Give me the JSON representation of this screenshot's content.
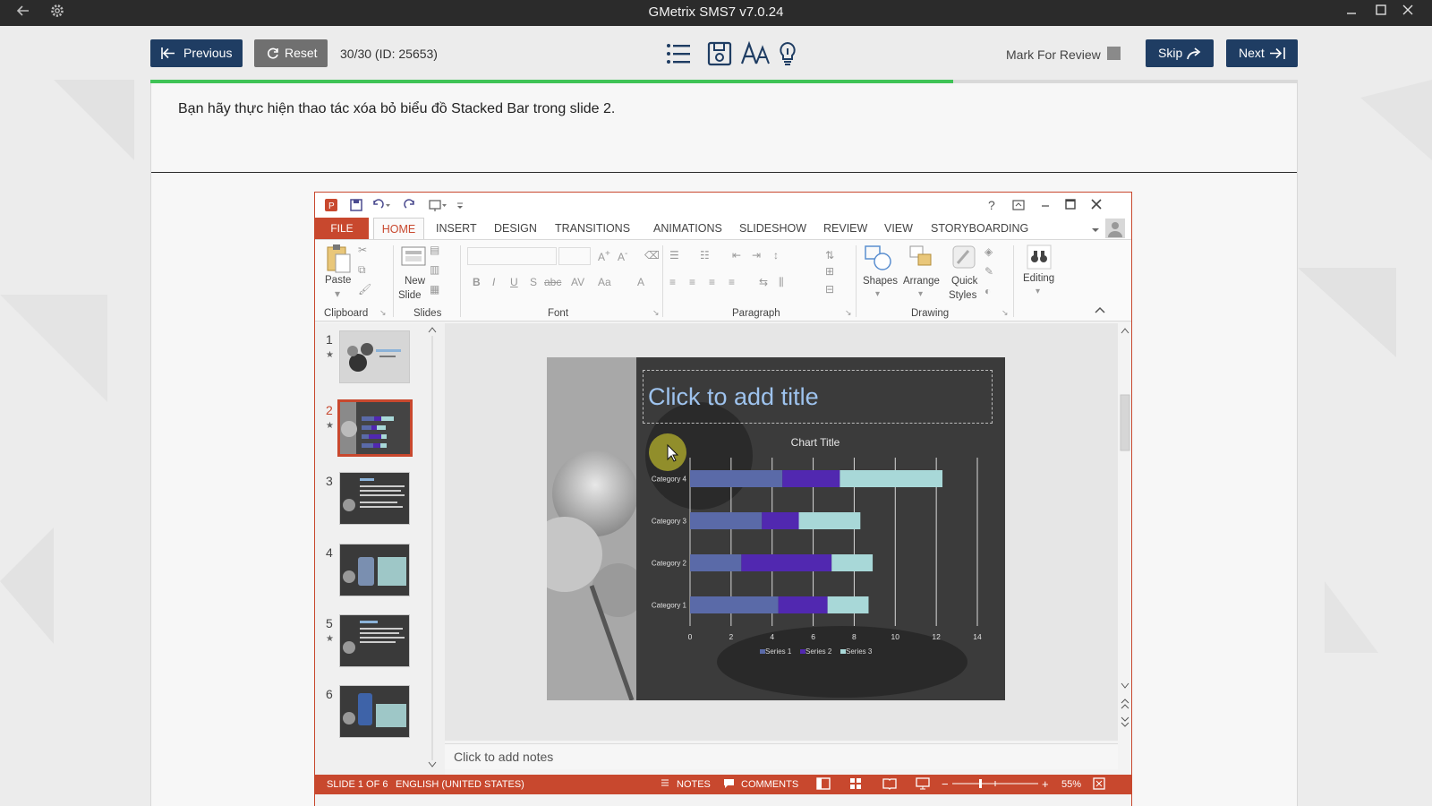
{
  "app": {
    "title": "GMetrix SMS7 v7.0.24"
  },
  "toolbar": {
    "previous_label": "Previous",
    "reset_label": "Reset",
    "question_counter": "30/30 (ID: 25653)",
    "mark_for_review_label": "Mark For Review",
    "mark_for_review_checked": false,
    "skip_label": "Skip",
    "next_label": "Next",
    "tool_icons": [
      "list-icon",
      "save-icon",
      "font-size-icon",
      "hint-icon"
    ],
    "accent_color": "#1f3d63"
  },
  "progress": {
    "fraction": 0.7,
    "color": "#3fc356"
  },
  "question": {
    "text": "Bạn hãy thực hiện thao tác xóa bỏ biểu đồ Stacked Bar trong slide 2."
  },
  "ppt": {
    "accent_color": "#c8482e",
    "qat_icons": [
      "powerpoint-icon",
      "save-icon",
      "undo-icon",
      "redo-icon",
      "touch-mode-icon",
      "customize-icon"
    ],
    "window_controls": [
      "?",
      "restore-ribbon",
      "minimize",
      "maximize",
      "close"
    ],
    "tabs": {
      "file": "FILE",
      "home": "HOME",
      "insert": "INSERT",
      "design": "DESIGN",
      "transitions": "TRANSITIONS",
      "animations": "ANIMATIONS",
      "slideshow": "SLIDESHOW",
      "review": "REVIEW",
      "view": "VIEW",
      "storyboarding": "STORYBOARDING"
    },
    "ribbon": {
      "paste": "Paste",
      "new": "New",
      "slide": "Slide",
      "shapes": "Shapes",
      "arrange": "Arrange",
      "quick": "Quick",
      "styles": "Styles",
      "editing": "Editing",
      "groups": {
        "clipboard": "Clipboard",
        "slides": "Slides",
        "font": "Font",
        "paragraph": "Paragraph",
        "drawing": "Drawing"
      }
    },
    "thumbnails": [
      {
        "num": "1",
        "star": true,
        "selected": false
      },
      {
        "num": "2",
        "star": true,
        "selected": true
      },
      {
        "num": "3",
        "star": false,
        "selected": false
      },
      {
        "num": "4",
        "star": false,
        "selected": false
      },
      {
        "num": "5",
        "star": true,
        "selected": false
      },
      {
        "num": "6",
        "star": false,
        "selected": false
      }
    ],
    "slide": {
      "title_placeholder": "Click to add title"
    },
    "notes_placeholder": "Click to add notes",
    "status": {
      "slide": "SLIDE 1 OF 6",
      "language": "ENGLISH (UNITED STATES)",
      "notes": "NOTES",
      "comments": "COMMENTS",
      "zoom": "55%"
    }
  },
  "chart_data": {
    "type": "bar",
    "orientation": "horizontal",
    "stacked": true,
    "title": "Chart Title",
    "categories": [
      "Category 1",
      "Category 2",
      "Category 3",
      "Category 4"
    ],
    "series": [
      {
        "name": "Series 1",
        "values": [
          4.3,
          2.5,
          3.5,
          4.5
        ],
        "color": "#5a6aa8"
      },
      {
        "name": "Series 2",
        "values": [
          2.4,
          4.4,
          1.8,
          2.8
        ],
        "color": "#5128b0"
      },
      {
        "name": "Series 3",
        "values": [
          2.0,
          2.0,
          3.0,
          5.0
        ],
        "color": "#a8d8d8"
      }
    ],
    "xlim": [
      0,
      14
    ],
    "xticks": [
      "0",
      "2",
      "4",
      "6",
      "8",
      "10",
      "12",
      "14"
    ],
    "grid": true,
    "legend": "bottom"
  }
}
